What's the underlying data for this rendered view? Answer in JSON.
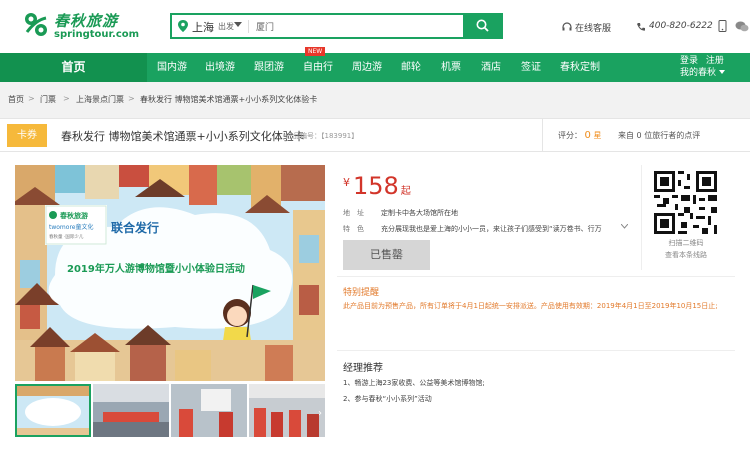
{
  "header": {
    "logo_cn": "春秋旅游",
    "logo_en": "springtour.com",
    "search": {
      "city": "上海",
      "depart_label": "出发",
      "value": "厦门"
    },
    "service_label": "在线客服",
    "phone": "400-820-6222"
  },
  "nav": {
    "home": "首页",
    "items": [
      "国内游",
      "出境游",
      "跟团游",
      "自由行",
      "周边游",
      "邮轮",
      "机票",
      "酒店",
      "签证",
      "春秋定制"
    ],
    "new_badge": "NEW",
    "login": "登录",
    "register": "注册",
    "my_account": "我的春秋"
  },
  "breadcrumb": [
    "首页",
    "门票",
    "上海景点门票",
    "春秋发行 博物馆美术馆通票+小小系列文化体验卡"
  ],
  "product": {
    "tag": "卡券",
    "title": "春秋发行 博物馆美术馆通票+小小系列文化体验卡",
    "code_label": "产品编号：",
    "code": "【183991】",
    "rating_label": "评分：",
    "rating_value": "0",
    "rating_unit": "星",
    "review_text": "来自 0 位旅行者的点评",
    "price_currency": "¥",
    "price": "158",
    "price_suffix": "起",
    "address_label": "地　址",
    "address": "定制卡中各大场馆所在地",
    "feature_label": "特　色",
    "feature": "充分展现我也是爱上海的小小一员，来让孩子们感受到“读万卷书、行万",
    "sold_out": "已售罄",
    "qr_label1": "扫描二维码",
    "qr_label2": "查看本条线路",
    "notice_title": "特别提醒",
    "notice_text": "此产品目前为预售产品，所有订单将于4月1日起统一安排派送。产品使用有效期：2019年4月1日至2019年10月15日止;",
    "rec_title": "经理推荐",
    "rec_items": [
      "1、畅游上海23家收费、公益等美术馆博物馆;",
      "2、参与春秋“小小系列”活动"
    ]
  },
  "hero_image": {
    "badge": "联合发行",
    "brand1": "春秋旅游",
    "brand2": "twomore童文化",
    "brand_sub": "春秋童 ·国际少儿",
    "banner": "2019年万人游博物馆暨小小体验日活动"
  },
  "colors": {
    "brand_green": "#1aa260",
    "price_red": "#d2352a",
    "notice_orange": "#e2792a",
    "tag_yellow": "#f6b93b"
  }
}
